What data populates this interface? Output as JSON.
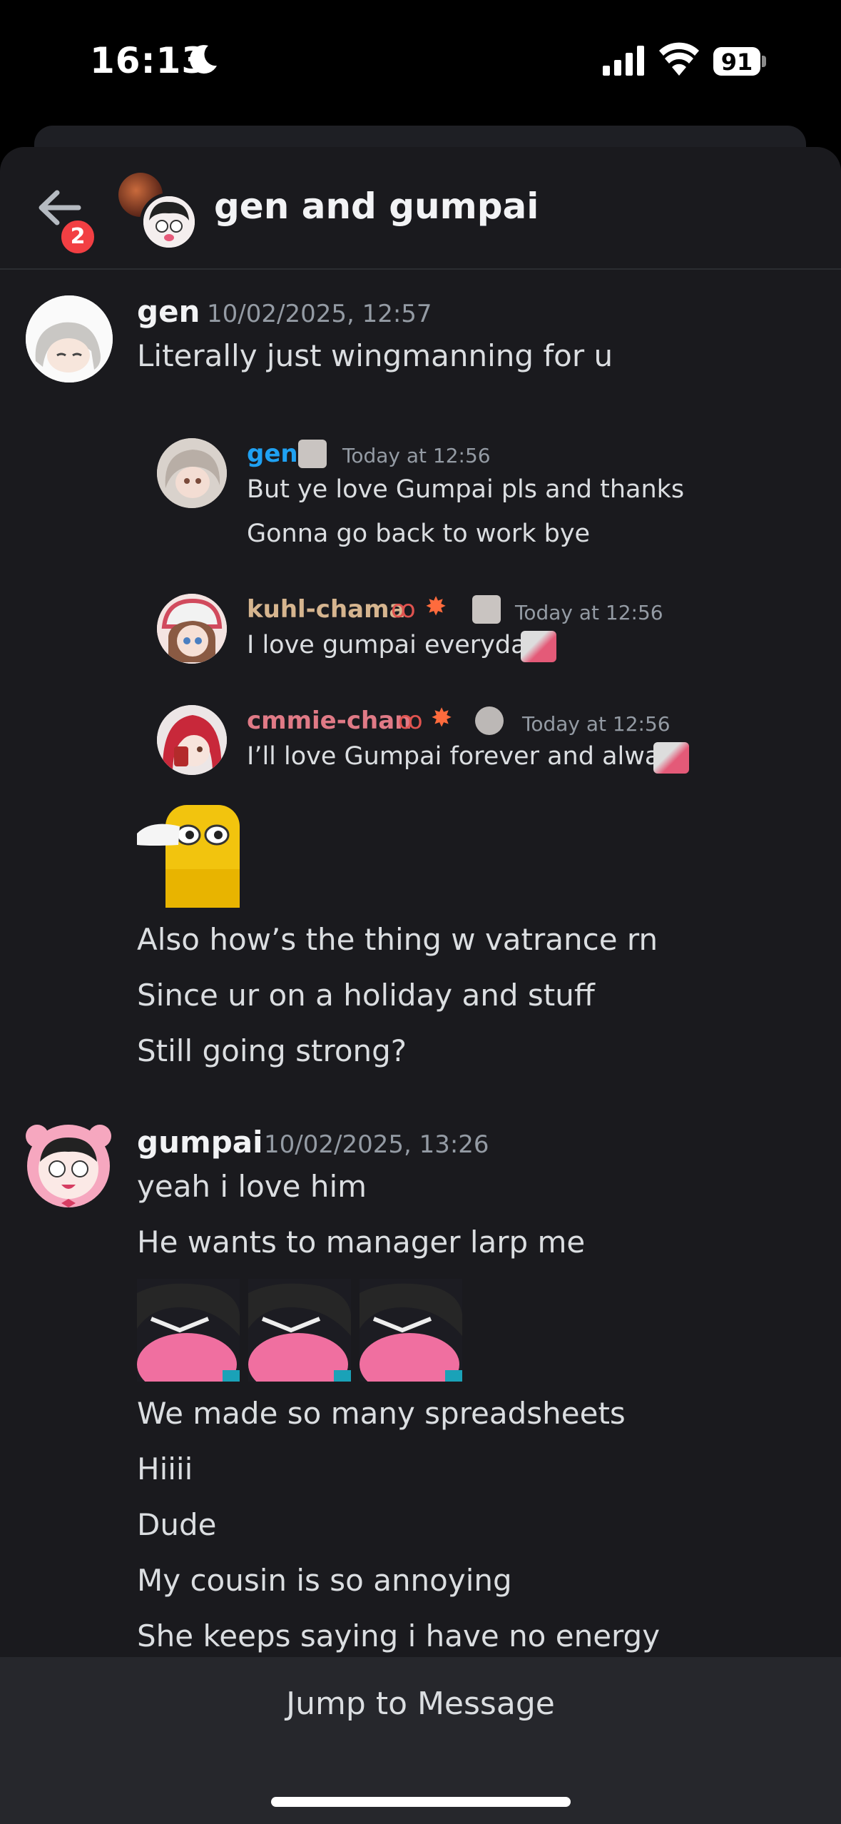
{
  "status_bar": {
    "time": "16:13",
    "battery": "91"
  },
  "header": {
    "title": "gen and gumpai",
    "unread_badge": "2"
  },
  "messages": [
    {
      "author": "gen",
      "timestamp": "10/02/2025, 12:57",
      "lines": [
        "Literally just wingmanning for u"
      ],
      "quoted": [
        {
          "author": "gen",
          "author_color": "#1fa1f2",
          "timestamp": "Today at 12:56",
          "lines": [
            "But ye love Gumpai pls and thanks",
            "Gonna go back to work bye"
          ]
        },
        {
          "author": "kuhl-chama",
          "author_color": "#d6b58f",
          "timestamp": "Today at 12:56",
          "lines": [
            "I love gumpai everyday!"
          ]
        },
        {
          "author": "cmmie-chan",
          "author_color": "#e07a86",
          "timestamp": "Today at 12:56",
          "lines": [
            "I’ll love Gumpai forever and always"
          ]
        }
      ],
      "lines_after": [
        "Also how’s the thing w vatrance rn",
        "Since ur on a holiday and stuff",
        "Still going strong?"
      ]
    },
    {
      "author": "gumpai",
      "timestamp": "10/02/2025, 13:26",
      "lines": [
        "yeah i love him",
        "He wants to manager larp me"
      ],
      "lines_after": [
        "We made so many spreadsheets",
        "Hiiii",
        "Dude",
        "My cousin is so annoying",
        "She keeps saying i have no energy"
      ]
    }
  ],
  "footer": {
    "jump_label": "Jump to Message"
  },
  "colors": {
    "background": "#1a1a1e",
    "bottom_bar": "#26272c",
    "badge": "#f23f43"
  }
}
